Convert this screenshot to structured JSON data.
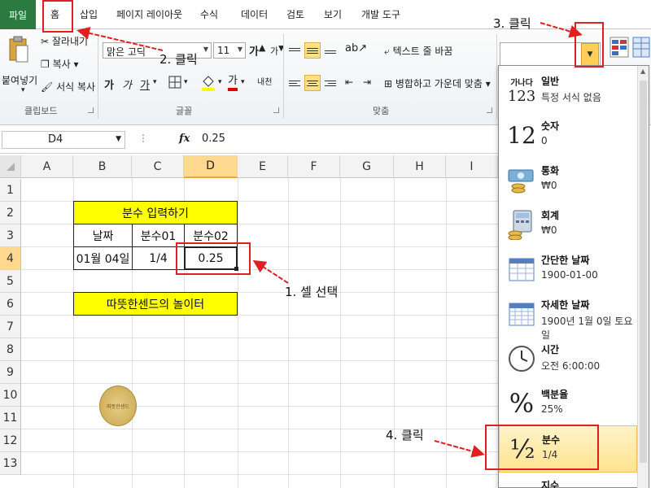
{
  "tabs": {
    "file": "파일",
    "home": "홈",
    "insert": "삽입",
    "page_layout": "페이지 레이아웃",
    "formulas": "수식",
    "data": "데이터",
    "review": "검토",
    "view": "보기",
    "developer": "개발 도구"
  },
  "clipboard": {
    "paste": "붙여넣기",
    "cut": "잘라내기",
    "copy": "복사",
    "format_painter": "서식 복사",
    "group_label": "클립보드"
  },
  "font": {
    "name": "맑은 고딕",
    "size": "11",
    "group_label": "글꼴",
    "bold": "가",
    "italic": "가",
    "underline": "가",
    "grow": "가",
    "shrink": "가",
    "color_letter": "가",
    "phonetic": "내천"
  },
  "alignment": {
    "wrap_text": "텍스트 줄 바꿈",
    "merge_center": "병합하고 가운데 맞춤",
    "group_label": "맞춤"
  },
  "number_format_box": {
    "value": ""
  },
  "formula_bar": {
    "name_box": "D4",
    "fx": "fx",
    "value": "0.25"
  },
  "columns": [
    "A",
    "B",
    "C",
    "D",
    "E",
    "F",
    "G",
    "H",
    "I"
  ],
  "rows": [
    "1",
    "2",
    "3",
    "4",
    "5",
    "6",
    "7",
    "8",
    "9",
    "10",
    "11",
    "12",
    "13"
  ],
  "sheet": {
    "title": "분수 입력하기",
    "headers": [
      "날짜",
      "분수01",
      "분수02"
    ],
    "row4": [
      "01월 04일",
      "1/4",
      "0.25"
    ],
    "banner": "따뜻한센드의 놀이터",
    "logo_text": "따뜻한센드"
  },
  "annotations": {
    "step1": "1. 셀 선택",
    "step2": "2. 클릭",
    "step3": "3. 클릭",
    "step4": "4. 클릭"
  },
  "number_formats": [
    {
      "icon_text": "가나다 123",
      "title": "일반",
      "sub": "특정 서식 없음"
    },
    {
      "icon_text": "12",
      "title": "숫자",
      "sub": "0"
    },
    {
      "icon_text": "",
      "title": "통화",
      "sub": "₩0"
    },
    {
      "icon_text": "",
      "title": "회계",
      "sub": "₩0"
    },
    {
      "icon_text": "",
      "title": "간단한 날짜",
      "sub": "1900-01-00"
    },
    {
      "icon_text": "",
      "title": "자세한 날짜",
      "sub": "1900년 1월 0일 토요일"
    },
    {
      "icon_text": "",
      "title": "시간",
      "sub": "오전 6:00:00"
    },
    {
      "icon_text": "%",
      "title": "백분율",
      "sub": "25%"
    },
    {
      "icon_text": "½",
      "title": "분수",
      "sub": "1/4"
    },
    {
      "icon_text": "",
      "title": "지수",
      "sub": ""
    }
  ],
  "colors": {
    "file_tab": "#2b7a3f",
    "header_fill": "#ffff00",
    "selection": "#ffd990",
    "annotation_red": "#e02020",
    "highlight": "#ffe38f"
  }
}
